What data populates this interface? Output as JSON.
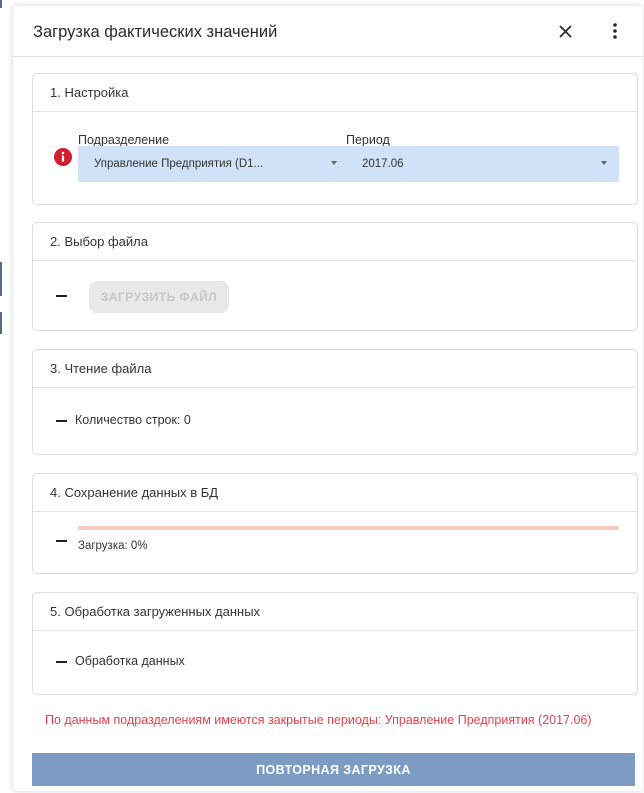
{
  "dialog": {
    "title": "Загрузка фактических значений",
    "close_icon": "close-icon",
    "more_icon": "more-vert-icon"
  },
  "sections": [
    {
      "title": "1. Настройка",
      "department_label": "Подразделение",
      "department_value": "Управление Предприятия (D1...",
      "period_label": "Период",
      "period_value": "2017.06",
      "status_icon": "error-icon",
      "select_color": "#cfe2f7"
    },
    {
      "title": "2. Выбор файла",
      "upload_button_label": "ЗАГРУЗИТЬ ФАЙЛ"
    },
    {
      "title": "3. Чтение файла",
      "status_text": "Количество строк: 0"
    },
    {
      "title": "4. Сохранение данных в БД",
      "status_text": "Загрузка: 0%",
      "progress_percent": 0,
      "progress_color": "#f6c9c2"
    },
    {
      "title": "5. Обработка загруженных данных",
      "status_text": "Обработка данных"
    }
  ],
  "error_message": "По данным подразделениям имеются закрытые периоды: Управление Предприятия (2017.06)",
  "retry_button_label": "ПОВТОРНАЯ ЗАГРУЗКА",
  "colors": {
    "error": "#e8414c",
    "primary_button": "#7c9cc4",
    "error_icon": "#d0202e"
  }
}
